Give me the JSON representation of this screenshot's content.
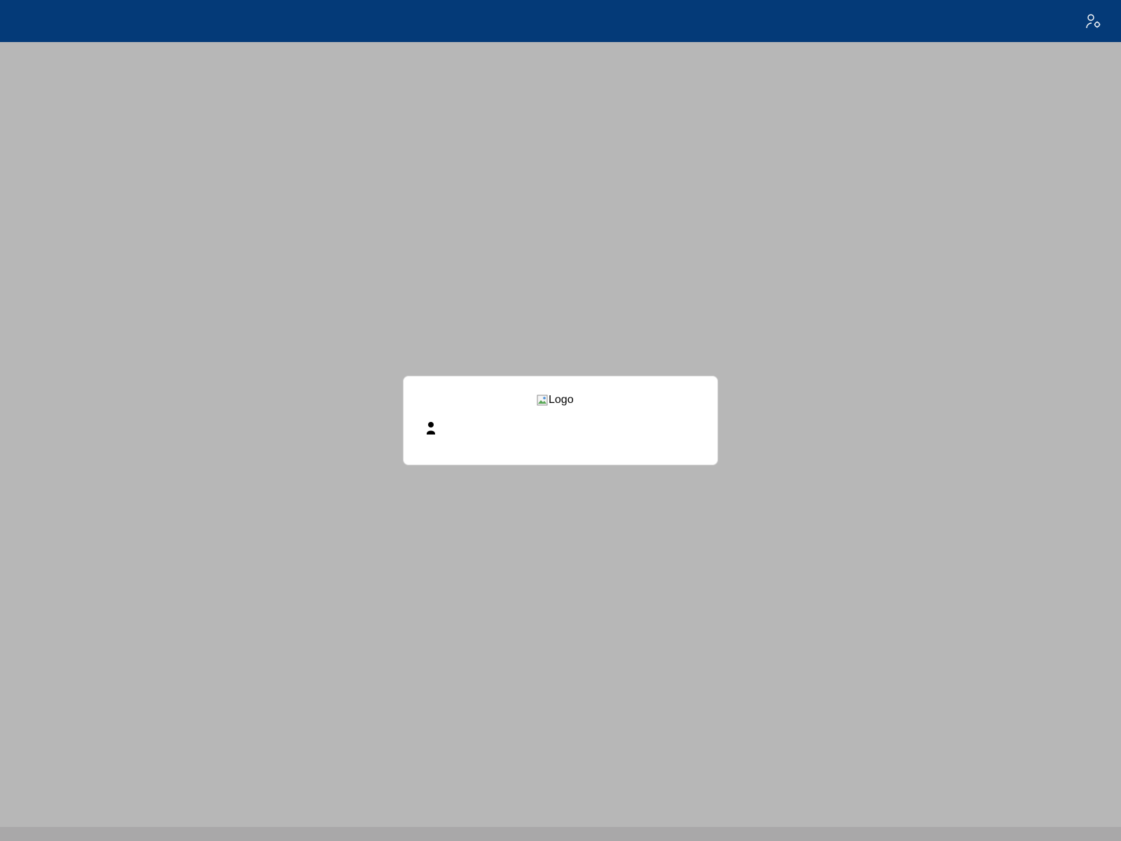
{
  "header": {
    "user_settings_icon": "user-settings-icon",
    "background_color": "#043a78"
  },
  "login_card": {
    "logo_alt": "Logo",
    "user_icon": "user-icon",
    "username_value": "",
    "username_placeholder": ""
  },
  "colors": {
    "page_background": "#b7b7b7",
    "card_background": "#ffffff",
    "footer_strip": "#a9a8a9"
  }
}
